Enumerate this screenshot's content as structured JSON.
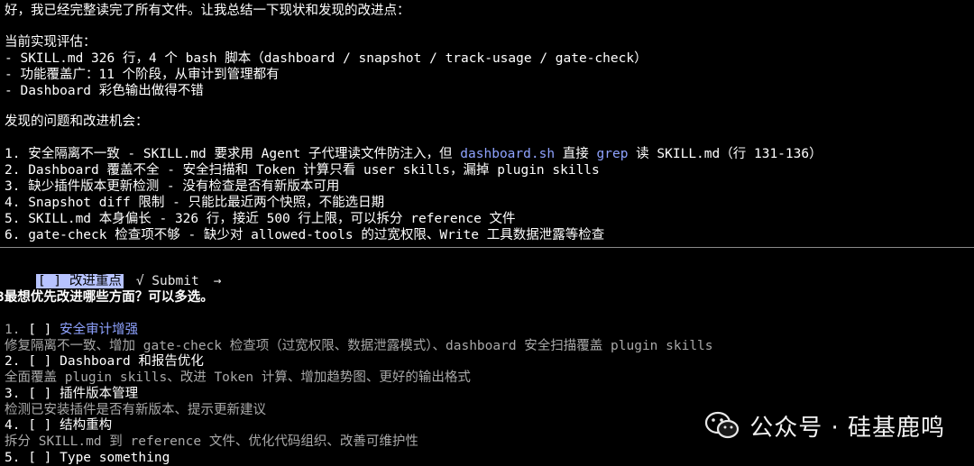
{
  "intro": "好，我已经完整读完了所有文件。让我总结一下现状和发现的改进点：",
  "current_heading": "当前实现评估：",
  "current_items": [
    "- SKILL.md 326 行，4 个 bash 脚本（dashboard / snapshot / track-usage / gate-check）",
    "- 功能覆盖广：11 个阶段，从审计到管理都有",
    "- Dashboard 彩色输出做得不错"
  ],
  "issues_heading": "发现的问题和改进机会：",
  "issues": [
    {
      "pre": "1. 安全隔离不一致 - SKILL.md 要求用 Agent 子代理读文件防注入，但 ",
      "hl1": "dashboard.sh",
      "mid": " 直接 ",
      "hl2": "grep",
      "post": " 读 SKILL.md（行 131-136）"
    },
    {
      "text": "2. Dashboard 覆盖不全 - 安全扫描和 Token 计算只看 user skills，漏掉 plugin skills"
    },
    {
      "text": "3. 缺少插件版本更新检测 - 没有检查是否有新版本可用"
    },
    {
      "text": "4. Snapshot diff 限制 - 只能比最近两个快照，不能选日期"
    },
    {
      "text": "5. SKILL.md 本身偏长 - 326 行，接近 500 行上限，可以拆分 reference 文件"
    },
    {
      "text": "6. gate-check 检查项不够 - 缺少对 allowed-tools 的过宽权限、Write 工具数据泄露等检查"
    }
  ],
  "tabs": {
    "active": "[ ] 改进重点",
    "submit": "√ Submit",
    "arrow": "→"
  },
  "question": "3最想优先改进哪些方面？可以多选。",
  "options": [
    {
      "label": "1. [ ] 安全审计增强",
      "desc": "修复隔离不一致、增加 gate-check 检查项（过宽权限、数据泄露模式）、dashboard 安全扫描覆盖 plugin skills",
      "selected": true
    },
    {
      "label": "2. [ ] Dashboard 和报告优化",
      "desc": "全面覆盖 plugin skills、改进 Token 计算、增加趋势图、更好的输出格式",
      "selected": false
    },
    {
      "label": "3. [ ] 插件版本管理",
      "desc": "检测已安装插件是否有新版本、提示更新建议",
      "selected": false
    },
    {
      "label": "4. [ ] 结构重构",
      "desc": "拆分 SKILL.md 到 reference 文件、优化代码组织、改善可维护性",
      "selected": false
    },
    {
      "label": "5. [ ] Type something",
      "desc": "",
      "selected": false
    }
  ],
  "watermark": "公众号 · 硅基鹿鸣",
  "colors": {
    "background": "#000000",
    "text": "#e6e6e6",
    "highlight_blue": "#8fa3ff",
    "tab_bg": "#b7c3ff",
    "dim": "#a9a9a9"
  }
}
